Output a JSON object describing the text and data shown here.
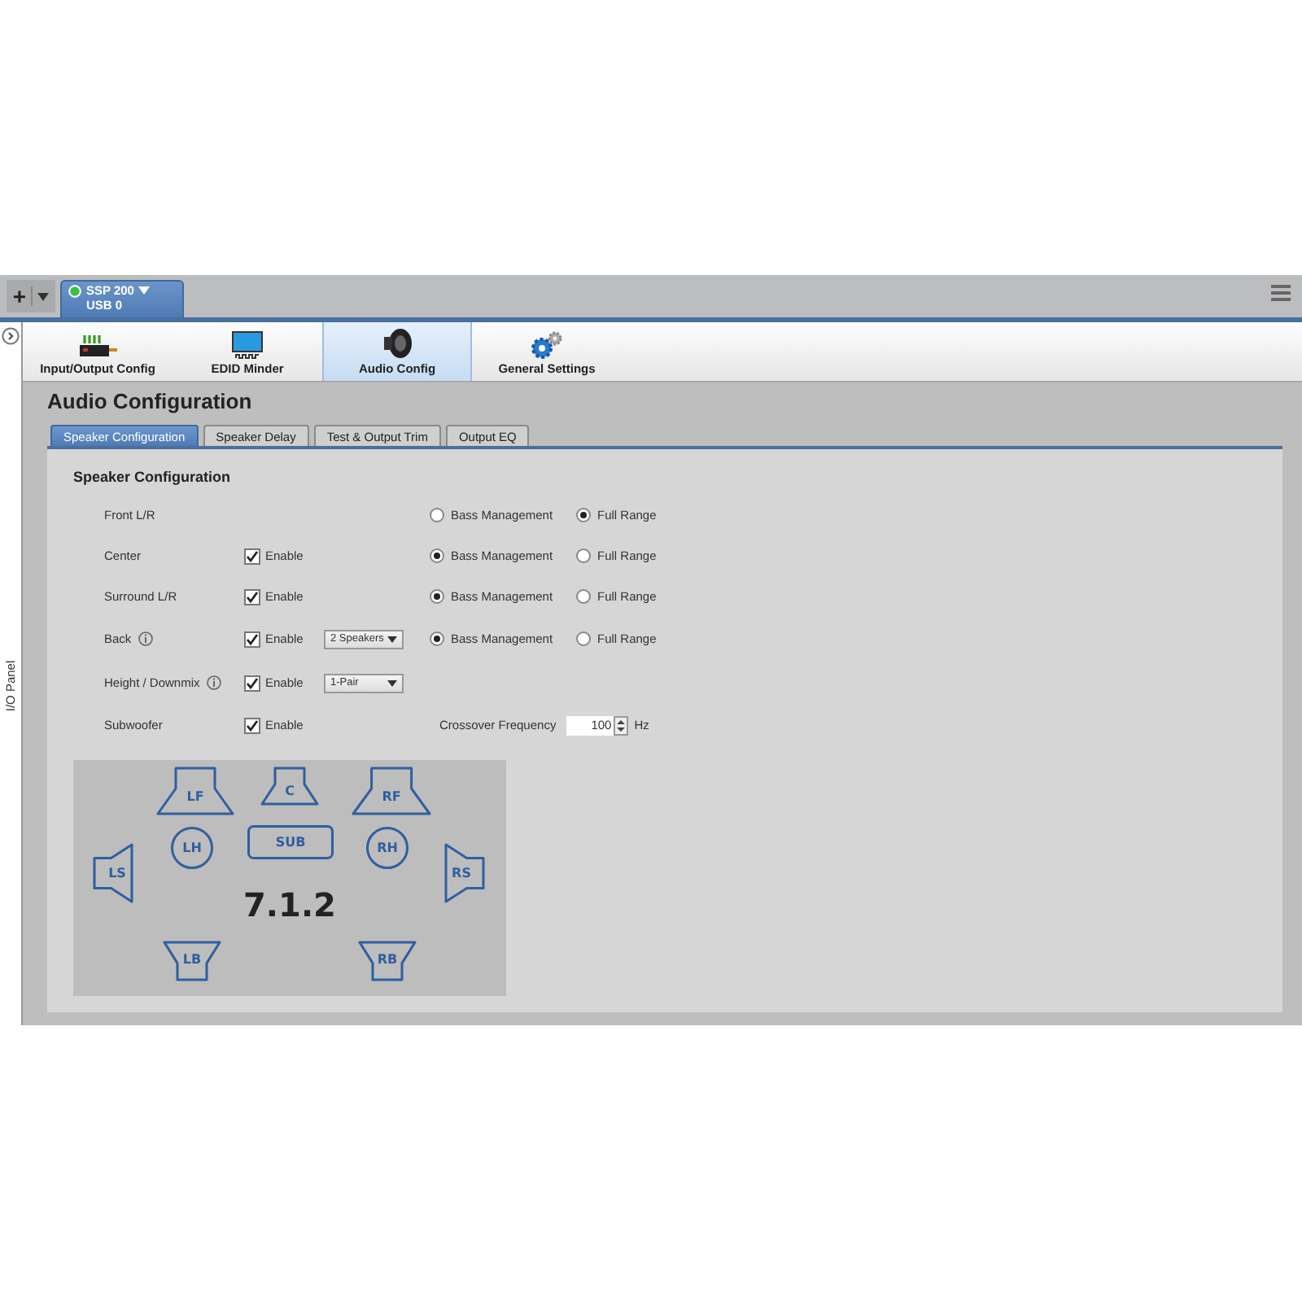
{
  "add_button": {
    "label": "+"
  },
  "device_tab": {
    "name": "SSP 200",
    "port": "USB 0",
    "connected": true
  },
  "side_panel": {
    "label": "I/O Panel"
  },
  "nav": [
    {
      "label": "Input/Output Config",
      "selected": false
    },
    {
      "label": "EDID Minder",
      "selected": false
    },
    {
      "label": "Audio Config",
      "selected": true
    },
    {
      "label": "General Settings",
      "selected": false
    }
  ],
  "page_title": "Audio Configuration",
  "tabs": [
    {
      "label": "Speaker Configuration",
      "selected": true
    },
    {
      "label": "Speaker Delay",
      "selected": false
    },
    {
      "label": "Test & Output Trim",
      "selected": false
    },
    {
      "label": "Output EQ",
      "selected": false
    }
  ],
  "section_title": "Speaker Configuration",
  "rows": [
    {
      "label": "Front L/R",
      "info": false,
      "mode": [
        {
          "label": "Bass Management",
          "selected": false
        },
        {
          "label": "Full Range",
          "selected": true
        }
      ]
    },
    {
      "label": "Center",
      "info": false,
      "enable": {
        "label": "Enable",
        "checked": true
      },
      "mode": [
        {
          "label": "Bass Management",
          "selected": true
        },
        {
          "label": "Full Range",
          "selected": false
        }
      ]
    },
    {
      "label": "Surround L/R",
      "info": false,
      "enable": {
        "label": "Enable",
        "checked": true
      },
      "mode": [
        {
          "label": "Bass Management",
          "selected": true
        },
        {
          "label": "Full Range",
          "selected": false
        }
      ]
    },
    {
      "label": "Back",
      "info": true,
      "enable": {
        "label": "Enable",
        "checked": true
      },
      "dropdown": "2 Speakers",
      "mode": [
        {
          "label": "Bass Management",
          "selected": true
        },
        {
          "label": "Full Range",
          "selected": false
        }
      ]
    },
    {
      "label": "Height / Downmix",
      "info": true,
      "enable": {
        "label": "Enable",
        "checked": true
      },
      "dropdown": "1-Pair"
    },
    {
      "label": "Subwoofer",
      "info": false,
      "enable": {
        "label": "Enable",
        "checked": true
      },
      "crossover": {
        "label": "Crossover Frequency",
        "value": "100",
        "unit": "Hz"
      }
    }
  ],
  "diagram": {
    "layout": "7.1.2",
    "speakers": [
      {
        "label": "LF",
        "kind": "front-left"
      },
      {
        "label": "C",
        "kind": "center"
      },
      {
        "label": "RF",
        "kind": "front-right"
      },
      {
        "label": "LH",
        "kind": "height-left"
      },
      {
        "label": "SUB",
        "kind": "sub"
      },
      {
        "label": "RH",
        "kind": "height-right"
      },
      {
        "label": "LS",
        "kind": "side-left"
      },
      {
        "label": "RS",
        "kind": "side-right"
      },
      {
        "label": "LB",
        "kind": "back-left"
      },
      {
        "label": "RB",
        "kind": "back-right"
      }
    ]
  }
}
